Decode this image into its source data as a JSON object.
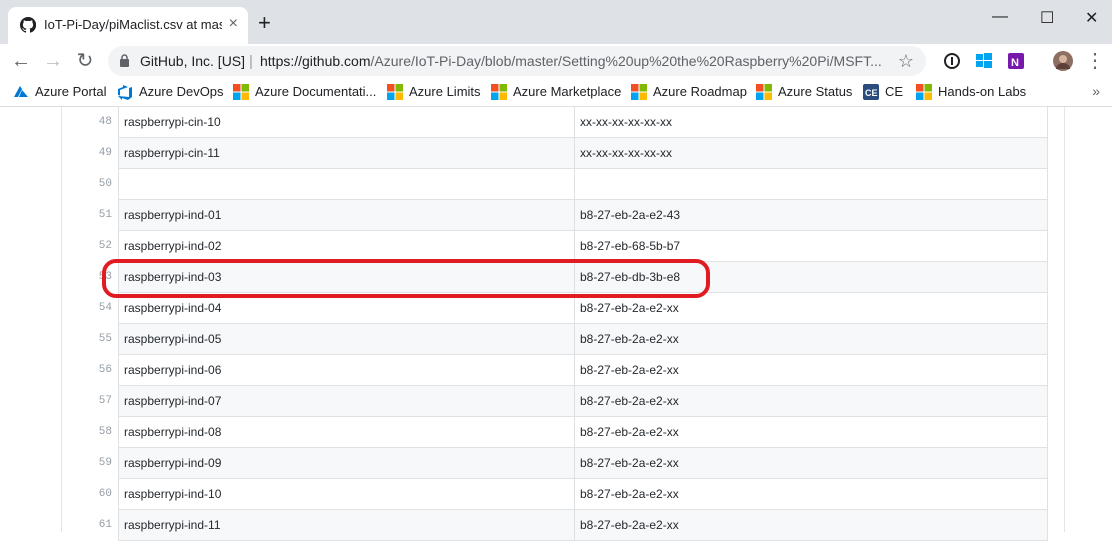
{
  "tab": {
    "title": "IoT-Pi-Day/piMaclist.csv at master · Azure/IoT-Pi-Day",
    "close": "×"
  },
  "window": {
    "minimize": "—",
    "maximize": "☐",
    "close": "✕",
    "new_tab": "+"
  },
  "toolbar": {
    "origin": "GitHub, Inc. [US]",
    "url_host": "https://github.com",
    "url_path": "/Azure/IoT-Pi-Day/blob/master/Setting%20up%20the%20Raspberry%20Pi/MSFT..."
  },
  "bookmarks": [
    {
      "label": "Azure Portal",
      "icon": "azure-icon"
    },
    {
      "label": "Azure DevOps",
      "icon": "azure-devops-icon"
    },
    {
      "label": "Azure Documentati...",
      "icon": "microsoft-icon"
    },
    {
      "label": "Azure Limits",
      "icon": "microsoft-icon"
    },
    {
      "label": "Azure Marketplace",
      "icon": "microsoft-icon"
    },
    {
      "label": "Azure Roadmap",
      "icon": "microsoft-icon"
    },
    {
      "label": "Azure Status",
      "icon": "microsoft-icon"
    },
    {
      "label": "CE",
      "icon": "ce-icon"
    },
    {
      "label": "Hands-on Labs",
      "icon": "microsoft-icon"
    }
  ],
  "csv_rows": [
    {
      "line": "48",
      "name": "raspberrypi-cin-10",
      "mac": "xx-xx-xx-xx-xx-xx"
    },
    {
      "line": "49",
      "name": "raspberrypi-cin-11",
      "mac": "xx-xx-xx-xx-xx-xx"
    },
    {
      "line": "50",
      "name": "",
      "mac": ""
    },
    {
      "line": "51",
      "name": "raspberrypi-ind-01",
      "mac": "b8-27-eb-2a-e2-43"
    },
    {
      "line": "52",
      "name": "raspberrypi-ind-02",
      "mac": "b8-27-eb-68-5b-b7"
    },
    {
      "line": "53",
      "name": "raspberrypi-ind-03",
      "mac": "b8-27-eb-db-3b-e8"
    },
    {
      "line": "54",
      "name": "raspberrypi-ind-04",
      "mac": "b8-27-eb-2a-e2-xx"
    },
    {
      "line": "55",
      "name": "raspberrypi-ind-05",
      "mac": "b8-27-eb-2a-e2-xx"
    },
    {
      "line": "56",
      "name": "raspberrypi-ind-06",
      "mac": "b8-27-eb-2a-e2-xx"
    },
    {
      "line": "57",
      "name": "raspberrypi-ind-07",
      "mac": "b8-27-eb-2a-e2-xx"
    },
    {
      "line": "58",
      "name": "raspberrypi-ind-08",
      "mac": "b8-27-eb-2a-e2-xx"
    },
    {
      "line": "59",
      "name": "raspberrypi-ind-09",
      "mac": "b8-27-eb-2a-e2-xx"
    },
    {
      "line": "60",
      "name": "raspberrypi-ind-10",
      "mac": "b8-27-eb-2a-e2-xx"
    },
    {
      "line": "61",
      "name": "raspberrypi-ind-11",
      "mac": "b8-27-eb-2a-e2-xx"
    }
  ],
  "highlighted_row": "53",
  "colors": {
    "highlight": "#e11b22",
    "tabbar": "#dee1e6"
  }
}
